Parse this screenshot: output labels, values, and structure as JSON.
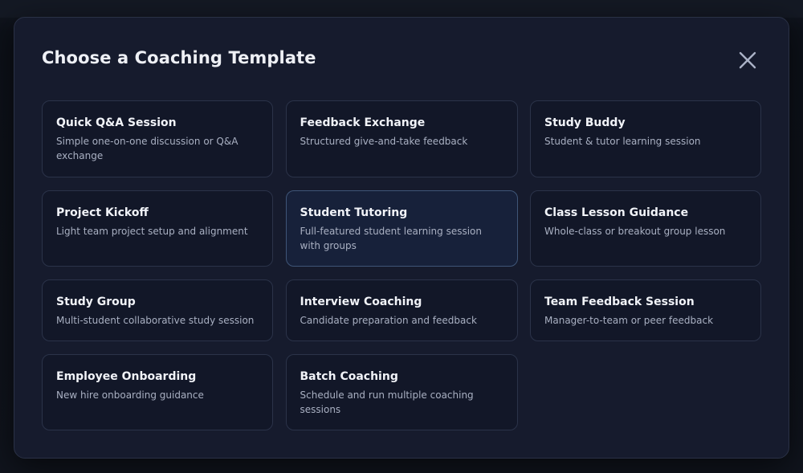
{
  "modal": {
    "title": "Choose a Coaching Template",
    "close_icon": "close-icon"
  },
  "templates": [
    {
      "title": "Quick Q&A Session",
      "description": "Simple one-on-one discussion or Q&A exchange",
      "selected": false
    },
    {
      "title": "Feedback Exchange",
      "description": "Structured give-and-take feedback",
      "selected": false
    },
    {
      "title": "Study Buddy",
      "description": "Student & tutor learning session",
      "selected": false
    },
    {
      "title": "Project Kickoff",
      "description": "Light team project setup and alignment",
      "selected": false
    },
    {
      "title": "Student Tutoring",
      "description": "Full-featured student learning session with groups",
      "selected": true
    },
    {
      "title": "Class Lesson Guidance",
      "description": "Whole-class or breakout group lesson",
      "selected": false
    },
    {
      "title": "Study Group",
      "description": "Multi-student collaborative study session",
      "selected": false
    },
    {
      "title": "Interview Coaching",
      "description": "Candidate preparation and feedback",
      "selected": false
    },
    {
      "title": "Team Feedback Session",
      "description": "Manager-to-team or peer feedback",
      "selected": false
    },
    {
      "title": "Employee Onboarding",
      "description": "New hire onboarding guidance",
      "selected": false
    },
    {
      "title": "Batch Coaching",
      "description": "Schedule and run multiple coaching sessions",
      "selected": false
    }
  ],
  "colors": {
    "modal_bg": "#161b2d",
    "card_bg": "#121728",
    "card_selected_bg": "#17213a",
    "card_selected_border": "#3f5577",
    "title_text": "#f1f3f8",
    "desc_text": "#a9b0c2"
  }
}
